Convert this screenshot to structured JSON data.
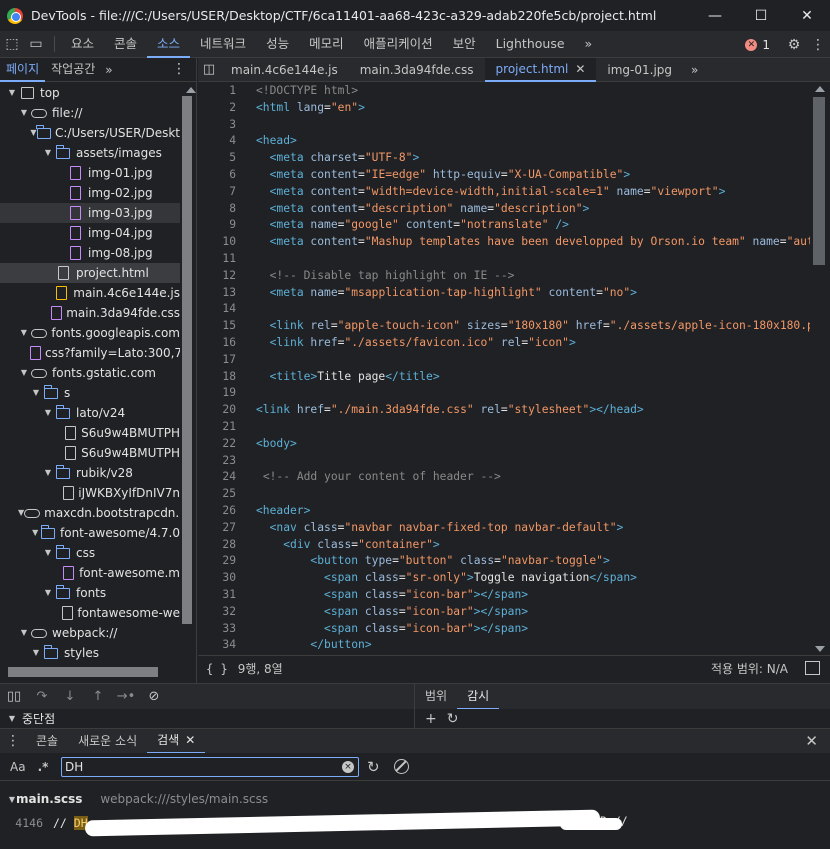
{
  "window": {
    "app_name": "DevTools",
    "title": "DevTools - file:///C:/Users/USER/Desktop/CTF/6ca11401-aa68-423c-a329-adab220fe5cb/project.html",
    "controls": [
      "—",
      "☐",
      "✕"
    ]
  },
  "main_tabs": {
    "items": [
      "요소",
      "콘솔",
      "소스",
      "네트워크",
      "성능",
      "메모리",
      "애플리케이션",
      "보안",
      "Lighthouse"
    ],
    "active": "소스",
    "more": "»",
    "error_count": "1",
    "error_glyph": "✕",
    "settings_glyph": "⚙",
    "kebab_glyph": "⋮",
    "inspect_glyph": "⬚",
    "device_glyph": "▭"
  },
  "navigator": {
    "tabs": [
      "페이지",
      "작업공간"
    ],
    "more": "»",
    "kebab": "⋮",
    "tree": [
      {
        "label": "top",
        "depth": 0,
        "icon": "frame-icon",
        "expanded": true
      },
      {
        "label": "file://",
        "depth": 1,
        "icon": "cloud-icon",
        "expanded": true
      },
      {
        "label": "C:/Users/USER/Deskt",
        "depth": 2,
        "icon": "folder-icon",
        "expanded": true
      },
      {
        "label": "assets/images",
        "depth": 3,
        "icon": "folder-icon",
        "expanded": true
      },
      {
        "label": "img-01.jpg",
        "depth": 4,
        "icon": "image-file-icon"
      },
      {
        "label": "img-02.jpg",
        "depth": 4,
        "icon": "image-file-icon"
      },
      {
        "label": "img-03.jpg",
        "depth": 4,
        "icon": "image-file-icon",
        "hover": true
      },
      {
        "label": "img-04.jpg",
        "depth": 4,
        "icon": "image-file-icon"
      },
      {
        "label": "img-08.jpg",
        "depth": 4,
        "icon": "image-file-icon"
      },
      {
        "label": "project.html",
        "depth": 3,
        "icon": "html-file-icon",
        "selected": true
      },
      {
        "label": "main.4c6e144e.js",
        "depth": 3,
        "icon": "js-file-icon"
      },
      {
        "label": "main.3da94fde.css",
        "depth": 3,
        "icon": "css-file-icon"
      },
      {
        "label": "fonts.googleapis.com",
        "depth": 1,
        "icon": "cloud-icon",
        "expanded": true
      },
      {
        "label": "css?family=Lato:300,7",
        "depth": 2,
        "icon": "css-file-icon"
      },
      {
        "label": "fonts.gstatic.com",
        "depth": 1,
        "icon": "cloud-icon",
        "expanded": true
      },
      {
        "label": "s",
        "depth": 2,
        "icon": "folder-icon",
        "expanded": true
      },
      {
        "label": "lato/v24",
        "depth": 3,
        "icon": "folder-icon",
        "expanded": true
      },
      {
        "label": "S6u9w4BMUTPH",
        "depth": 4,
        "icon": "font-file-icon"
      },
      {
        "label": "S6u9w4BMUTPH",
        "depth": 4,
        "icon": "font-file-icon"
      },
      {
        "label": "rubik/v28",
        "depth": 3,
        "icon": "folder-icon",
        "expanded": true
      },
      {
        "label": "iJWKBXyIfDnIV7n",
        "depth": 4,
        "icon": "font-file-icon"
      },
      {
        "label": "maxcdn.bootstrapcdn.c",
        "depth": 1,
        "icon": "cloud-icon",
        "expanded": true
      },
      {
        "label": "font-awesome/4.7.0",
        "depth": 2,
        "icon": "folder-icon",
        "expanded": true
      },
      {
        "label": "css",
        "depth": 3,
        "icon": "folder-icon",
        "expanded": true
      },
      {
        "label": "font-awesome.m",
        "depth": 4,
        "icon": "css-file-icon"
      },
      {
        "label": "fonts",
        "depth": 3,
        "icon": "folder-icon",
        "expanded": true
      },
      {
        "label": "fontawesome-we",
        "depth": 4,
        "icon": "font-file-icon"
      },
      {
        "label": "webpack://",
        "depth": 1,
        "icon": "cloud-icon",
        "expanded": true
      },
      {
        "label": "styles",
        "depth": 2,
        "icon": "folder-icon",
        "expanded": true
      }
    ]
  },
  "editor": {
    "tabs": [
      {
        "label": "main.4c6e144e.js",
        "active": false,
        "closable": false
      },
      {
        "label": "main.3da94fde.css",
        "active": false,
        "closable": false
      },
      {
        "label": "project.html",
        "active": true,
        "closable": true
      },
      {
        "label": "img-01.jpg",
        "active": false,
        "closable": false
      }
    ],
    "more": "»",
    "lines": [
      {
        "n": "1",
        "tokens": [
          [
            "t-cmt",
            "<!DOCTYPE html>"
          ]
        ]
      },
      {
        "n": "2",
        "tokens": [
          [
            "t-tag",
            "<html "
          ],
          [
            "t-attr",
            "lang"
          ],
          [
            "t-txt",
            "="
          ],
          [
            "t-val",
            "\"en\""
          ],
          [
            "t-tag",
            ">"
          ]
        ]
      },
      {
        "n": "3",
        "tokens": []
      },
      {
        "n": "4",
        "tokens": [
          [
            "t-tag",
            "<head>"
          ]
        ]
      },
      {
        "n": "5",
        "tokens": [
          [
            "t-txt",
            "  "
          ],
          [
            "t-tag",
            "<meta "
          ],
          [
            "t-attr",
            "charset"
          ],
          [
            "t-txt",
            "="
          ],
          [
            "t-val",
            "\"UTF-8\""
          ],
          [
            "t-tag",
            ">"
          ]
        ]
      },
      {
        "n": "6",
        "tokens": [
          [
            "t-txt",
            "  "
          ],
          [
            "t-tag",
            "<meta "
          ],
          [
            "t-attr",
            "content"
          ],
          [
            "t-txt",
            "="
          ],
          [
            "t-val",
            "\"IE=edge\""
          ],
          [
            "t-txt",
            " "
          ],
          [
            "t-attr",
            "http-equiv"
          ],
          [
            "t-txt",
            "="
          ],
          [
            "t-val",
            "\"X-UA-Compatible\""
          ],
          [
            "t-tag",
            ">"
          ]
        ]
      },
      {
        "n": "7",
        "tokens": [
          [
            "t-txt",
            "  "
          ],
          [
            "t-tag",
            "<meta "
          ],
          [
            "t-attr",
            "content"
          ],
          [
            "t-txt",
            "="
          ],
          [
            "t-val",
            "\"width=device-width,initial-scale=1\""
          ],
          [
            "t-txt",
            " "
          ],
          [
            "t-attr",
            "name"
          ],
          [
            "t-txt",
            "="
          ],
          [
            "t-val",
            "\"viewport\""
          ],
          [
            "t-tag",
            ">"
          ]
        ]
      },
      {
        "n": "8",
        "tokens": [
          [
            "t-txt",
            "  "
          ],
          [
            "t-tag",
            "<meta "
          ],
          [
            "t-attr",
            "content"
          ],
          [
            "t-txt",
            "="
          ],
          [
            "t-val",
            "\"description\""
          ],
          [
            "t-txt",
            " "
          ],
          [
            "t-attr",
            "name"
          ],
          [
            "t-txt",
            "="
          ],
          [
            "t-val",
            "\"description\""
          ],
          [
            "t-tag",
            ">"
          ]
        ]
      },
      {
        "n": "9",
        "tokens": [
          [
            "t-txt",
            "  "
          ],
          [
            "t-tag",
            "<meta "
          ],
          [
            "t-attr",
            "name"
          ],
          [
            "t-txt",
            "="
          ],
          [
            "t-val",
            "\"google\""
          ],
          [
            "t-txt",
            " "
          ],
          [
            "t-attr",
            "content"
          ],
          [
            "t-txt",
            "="
          ],
          [
            "t-val",
            "\"notranslate\""
          ],
          [
            "t-txt",
            " "
          ],
          [
            "t-tag",
            "/>"
          ]
        ]
      },
      {
        "n": "10",
        "tokens": [
          [
            "t-txt",
            "  "
          ],
          [
            "t-tag",
            "<meta "
          ],
          [
            "t-attr",
            "content"
          ],
          [
            "t-txt",
            "="
          ],
          [
            "t-val",
            "\"Mashup templates have been developped by Orson.io team\""
          ],
          [
            "t-txt",
            " "
          ],
          [
            "t-attr",
            "name"
          ],
          [
            "t-txt",
            "="
          ],
          [
            "t-val",
            "\"author\""
          ],
          [
            "t-tag",
            ">"
          ]
        ]
      },
      {
        "n": "11",
        "tokens": []
      },
      {
        "n": "12",
        "tokens": [
          [
            "t-txt",
            "  "
          ],
          [
            "t-cmt",
            "<!-- Disable tap highlight on IE -->"
          ]
        ]
      },
      {
        "n": "13",
        "tokens": [
          [
            "t-txt",
            "  "
          ],
          [
            "t-tag",
            "<meta "
          ],
          [
            "t-attr",
            "name"
          ],
          [
            "t-txt",
            "="
          ],
          [
            "t-val",
            "\"msapplication-tap-highlight\""
          ],
          [
            "t-txt",
            " "
          ],
          [
            "t-attr",
            "content"
          ],
          [
            "t-txt",
            "="
          ],
          [
            "t-val",
            "\"no\""
          ],
          [
            "t-tag",
            ">"
          ]
        ]
      },
      {
        "n": "14",
        "tokens": []
      },
      {
        "n": "15",
        "tokens": [
          [
            "t-txt",
            "  "
          ],
          [
            "t-tag",
            "<link "
          ],
          [
            "t-attr",
            "rel"
          ],
          [
            "t-txt",
            "="
          ],
          [
            "t-val",
            "\"apple-touch-icon\""
          ],
          [
            "t-txt",
            " "
          ],
          [
            "t-attr",
            "sizes"
          ],
          [
            "t-txt",
            "="
          ],
          [
            "t-val",
            "\"180x180\""
          ],
          [
            "t-txt",
            " "
          ],
          [
            "t-attr",
            "href"
          ],
          [
            "t-txt",
            "="
          ],
          [
            "t-val",
            "\"./assets/apple-icon-180x180.png\""
          ],
          [
            "t-tag",
            ">"
          ]
        ]
      },
      {
        "n": "16",
        "tokens": [
          [
            "t-txt",
            "  "
          ],
          [
            "t-tag",
            "<link "
          ],
          [
            "t-attr",
            "href"
          ],
          [
            "t-txt",
            "="
          ],
          [
            "t-val",
            "\"./assets/favicon.ico\""
          ],
          [
            "t-txt",
            " "
          ],
          [
            "t-attr",
            "rel"
          ],
          [
            "t-txt",
            "="
          ],
          [
            "t-val",
            "\"icon\""
          ],
          [
            "t-tag",
            ">"
          ]
        ]
      },
      {
        "n": "17",
        "tokens": []
      },
      {
        "n": "18",
        "tokens": [
          [
            "t-txt",
            "  "
          ],
          [
            "t-tag",
            "<title>"
          ],
          [
            "t-txt",
            "Title page"
          ],
          [
            "t-tag",
            "</title>"
          ]
        ]
      },
      {
        "n": "19",
        "tokens": []
      },
      {
        "n": "20",
        "tokens": [
          [
            "t-tag",
            "<link "
          ],
          [
            "t-attr",
            "href"
          ],
          [
            "t-txt",
            "="
          ],
          [
            "t-val",
            "\"./main.3da94fde.css\""
          ],
          [
            "t-txt",
            " "
          ],
          [
            "t-attr",
            "rel"
          ],
          [
            "t-txt",
            "="
          ],
          [
            "t-val",
            "\"stylesheet\""
          ],
          [
            "t-tag",
            "></head>"
          ]
        ]
      },
      {
        "n": "21",
        "tokens": []
      },
      {
        "n": "22",
        "tokens": [
          [
            "t-tag",
            "<body>"
          ]
        ]
      },
      {
        "n": "23",
        "tokens": []
      },
      {
        "n": "24",
        "tokens": [
          [
            "t-txt",
            " "
          ],
          [
            "t-cmt",
            "<!-- Add your content of header -->"
          ]
        ]
      },
      {
        "n": "25",
        "tokens": []
      },
      {
        "n": "26",
        "tokens": [
          [
            "t-tag",
            "<header>"
          ]
        ]
      },
      {
        "n": "27",
        "tokens": [
          [
            "t-txt",
            "  "
          ],
          [
            "t-tag",
            "<nav "
          ],
          [
            "t-attr",
            "class"
          ],
          [
            "t-txt",
            "="
          ],
          [
            "t-val",
            "\"navbar navbar-fixed-top navbar-default\""
          ],
          [
            "t-tag",
            ">"
          ]
        ]
      },
      {
        "n": "28",
        "tokens": [
          [
            "t-txt",
            "    "
          ],
          [
            "t-tag",
            "<div "
          ],
          [
            "t-attr",
            "class"
          ],
          [
            "t-txt",
            "="
          ],
          [
            "t-val",
            "\"container\""
          ],
          [
            "t-tag",
            ">"
          ]
        ]
      },
      {
        "n": "29",
        "tokens": [
          [
            "t-txt",
            "        "
          ],
          [
            "t-tag",
            "<button "
          ],
          [
            "t-attr",
            "type"
          ],
          [
            "t-txt",
            "="
          ],
          [
            "t-val",
            "\"button\""
          ],
          [
            "t-txt",
            " "
          ],
          [
            "t-attr",
            "class"
          ],
          [
            "t-txt",
            "="
          ],
          [
            "t-val",
            "\"navbar-toggle\""
          ],
          [
            "t-tag",
            ">"
          ]
        ]
      },
      {
        "n": "30",
        "tokens": [
          [
            "t-txt",
            "          "
          ],
          [
            "t-tag",
            "<span "
          ],
          [
            "t-attr",
            "class"
          ],
          [
            "t-txt",
            "="
          ],
          [
            "t-val",
            "\"sr-only\""
          ],
          [
            "t-tag",
            ">"
          ],
          [
            "t-txt",
            "Toggle navigation"
          ],
          [
            "t-tag",
            "</span>"
          ]
        ]
      },
      {
        "n": "31",
        "tokens": [
          [
            "t-txt",
            "          "
          ],
          [
            "t-tag",
            "<span "
          ],
          [
            "t-attr",
            "class"
          ],
          [
            "t-txt",
            "="
          ],
          [
            "t-val",
            "\"icon-bar\""
          ],
          [
            "t-tag",
            "></span>"
          ]
        ]
      },
      {
        "n": "32",
        "tokens": [
          [
            "t-txt",
            "          "
          ],
          [
            "t-tag",
            "<span "
          ],
          [
            "t-attr",
            "class"
          ],
          [
            "t-txt",
            "="
          ],
          [
            "t-val",
            "\"icon-bar\""
          ],
          [
            "t-tag",
            "></span>"
          ]
        ]
      },
      {
        "n": "33",
        "tokens": [
          [
            "t-txt",
            "          "
          ],
          [
            "t-tag",
            "<span "
          ],
          [
            "t-attr",
            "class"
          ],
          [
            "t-txt",
            "="
          ],
          [
            "t-val",
            "\"icon-bar\""
          ],
          [
            "t-tag",
            "></span>"
          ]
        ]
      },
      {
        "n": "34",
        "tokens": [
          [
            "t-txt",
            "        "
          ],
          [
            "t-tag",
            "</button>"
          ]
        ]
      }
    ],
    "status": {
      "braces": "{ }",
      "cursor_position": "9행, 8열",
      "coverage": "적용 범위: N/A"
    }
  },
  "debugger": {
    "toolbar_glyphs": [
      "▯▯",
      "↷",
      "↓",
      "↑",
      "→•",
      "⊘"
    ],
    "breakpoints_label": "중단점",
    "scope_tabs": [
      "범위",
      "감시"
    ],
    "active_scope_tab": "감시",
    "scope_actions": [
      "+",
      "↻"
    ]
  },
  "drawer": {
    "tabs": [
      "콘솔",
      "새로운 소식",
      "검색"
    ],
    "active": "검색",
    "kebab": "⋮",
    "close": "✕"
  },
  "search": {
    "match_case_label": "Aa",
    "regex_label": ".*",
    "query": "DH",
    "clear_glyph": "×",
    "refresh_glyph": "↻",
    "result_file_name": "main.scss",
    "result_file_path": "webpack:///styles/main.scss",
    "result_line_number": "4146",
    "result_prefix": "// ",
    "result_match": "DH",
    "result_visible_tail": "R //"
  }
}
